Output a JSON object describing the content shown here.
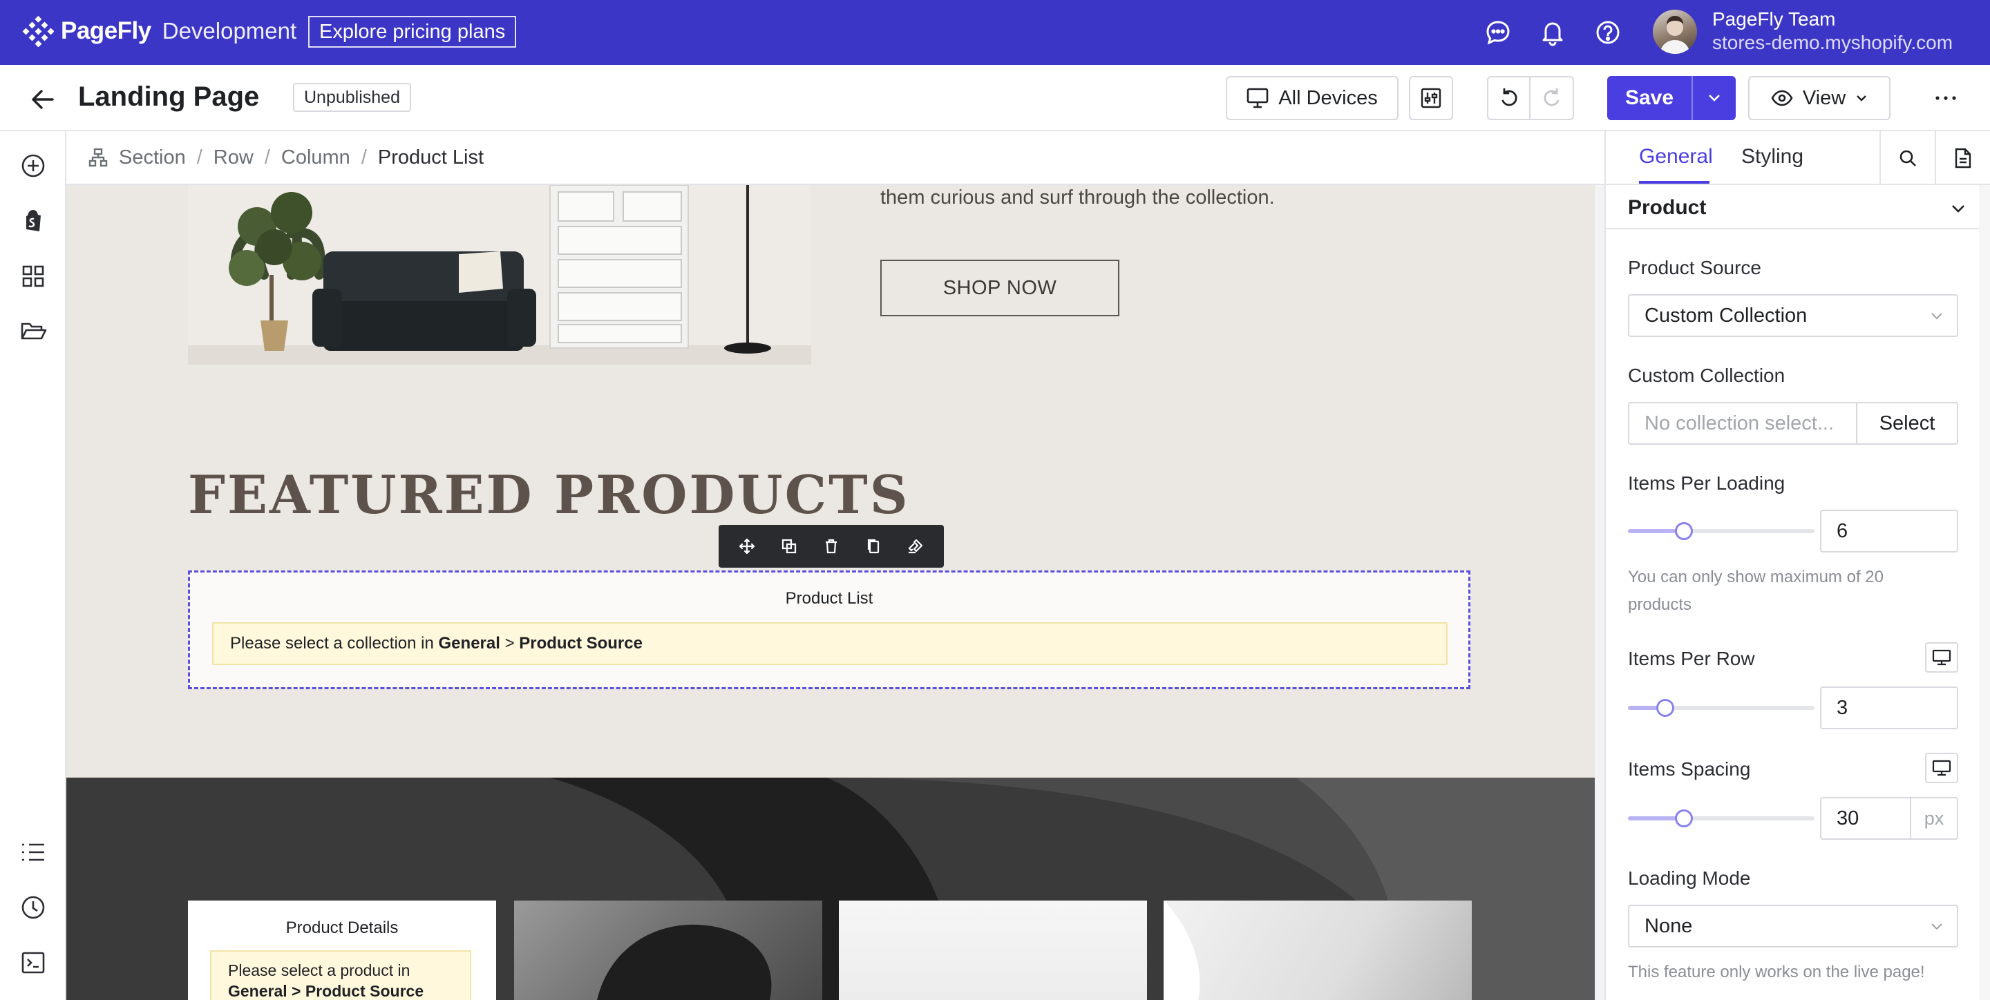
{
  "topbar": {
    "brand_name": "PageFly",
    "brand_env": "Development",
    "pricing_label": "Explore pricing plans",
    "user_name": "PageFly Team",
    "user_store": "stores-demo.myshopify.com"
  },
  "toolbar": {
    "page_title": "Landing Page",
    "status": "Unpublished",
    "device_label": "All Devices",
    "save_label": "Save",
    "view_label": "View"
  },
  "breadcrumb": [
    "Section",
    "Row",
    "Column",
    "Product List"
  ],
  "canvas": {
    "hero_copy": "them curious and surf through the collection.",
    "shop_button": "SHOP NOW",
    "featured_title": "FEATURED PRODUCTS",
    "product_list_title": "Product List",
    "product_list_warning_prefix": "Please select a collection in",
    "product_list_warning_general": "General",
    "product_list_warning_sep": ">",
    "product_list_warning_source": "Product Source",
    "product_details_title": "Product Details",
    "product_details_warning_prefix": "Please select a product in",
    "product_details_warning_path": "General > Product Source"
  },
  "panel": {
    "tabs": [
      "General",
      "Styling"
    ],
    "section_title": "Product",
    "product_source_label": "Product Source",
    "product_source_value": "Custom Collection",
    "custom_collection_label": "Custom Collection",
    "custom_collection_placeholder": "No collection select...",
    "custom_collection_button": "Select",
    "items_per_loading_label": "Items Per Loading",
    "items_per_loading_value": "6",
    "items_per_loading_fraction": 0.3,
    "items_per_loading_help": "You can only show maximum of 20 products",
    "items_per_row_label": "Items Per Row",
    "items_per_row_value": "3",
    "items_per_row_fraction": 0.2,
    "items_spacing_label": "Items Spacing",
    "items_spacing_value": "30",
    "items_spacing_unit": "px",
    "items_spacing_fraction": 0.3,
    "loading_mode_label": "Loading Mode",
    "loading_mode_value": "None",
    "loading_mode_help": "This feature only works on the live page!"
  },
  "colors": {
    "brand_bar": "#3c36c6",
    "accent": "#4b3ee0",
    "warning_bg": "#fff8dc"
  }
}
